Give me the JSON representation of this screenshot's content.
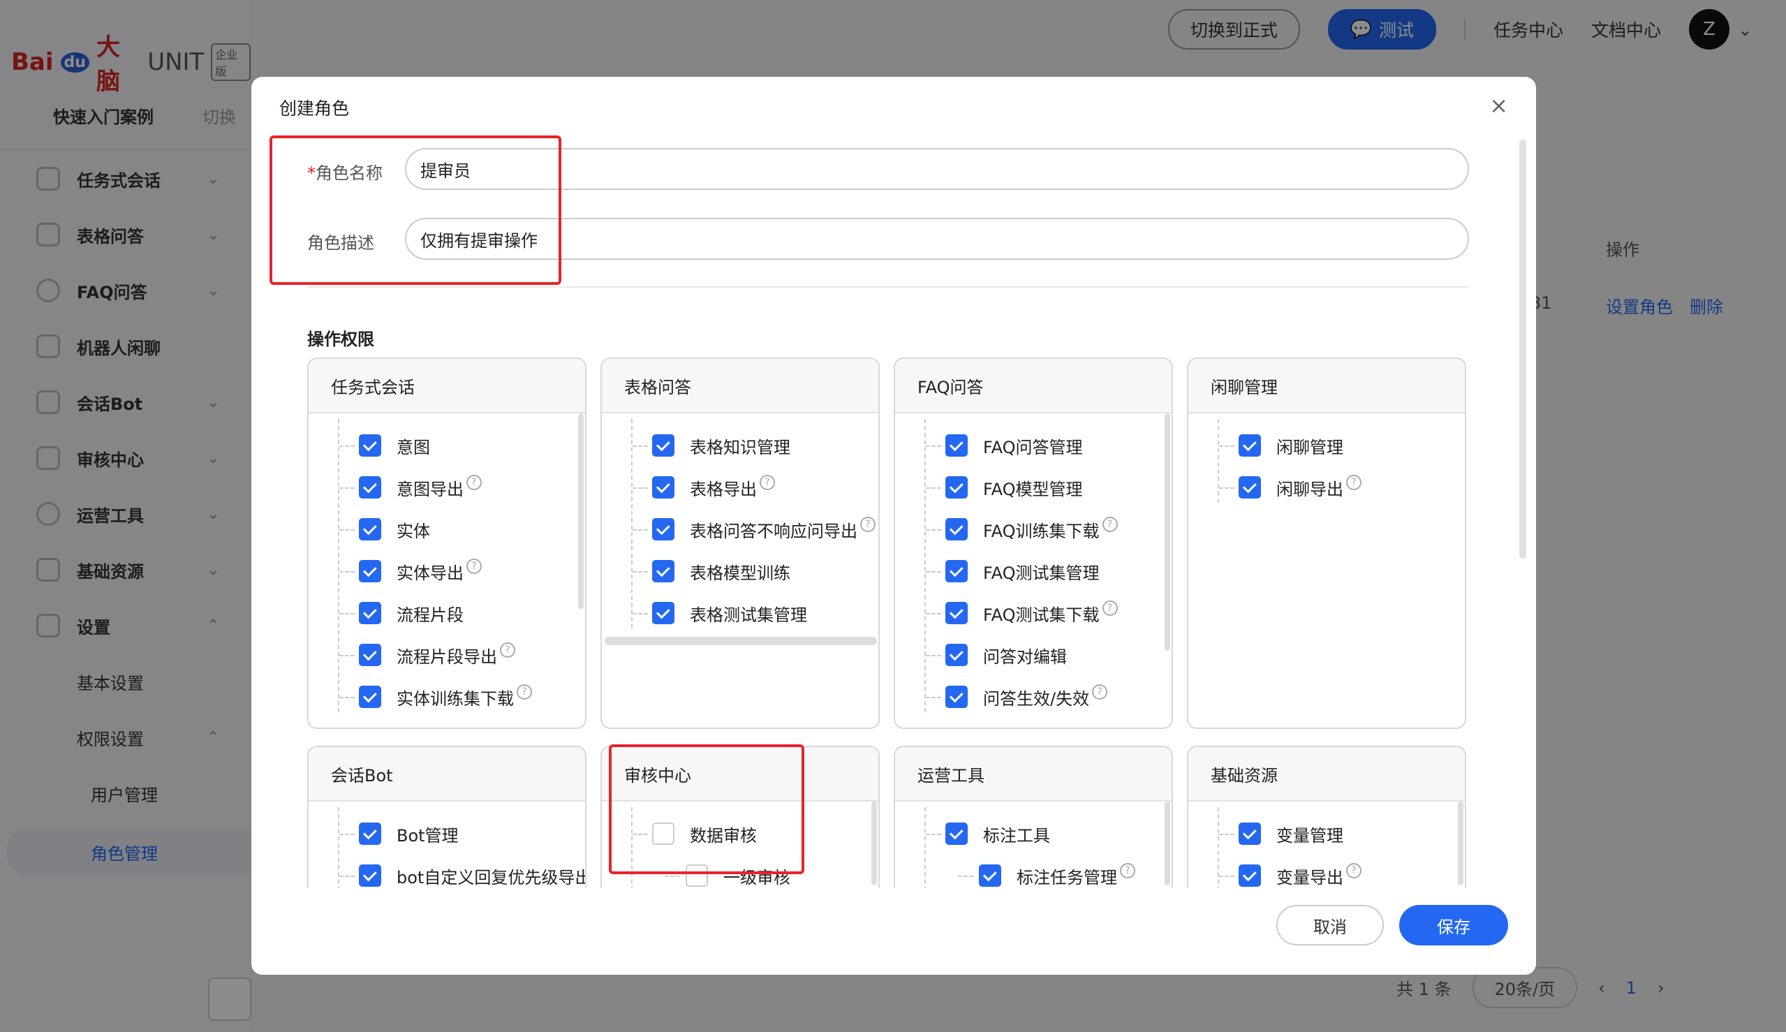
{
  "topbar": {
    "switch_formal": "切换到正式",
    "test": "测试",
    "task_center": "任务中心",
    "doc_center": "文档中心",
    "avatar_letter": "Z"
  },
  "sidebar": {
    "logo_main": "Bai",
    "logo_du": "du",
    "logo_brain": "大脑",
    "logo_unit": "UNIT",
    "logo_edition": "企业版",
    "quick_start": "快速入门案例",
    "switch": "切换",
    "items": [
      {
        "label": "任务式会话",
        "chev": "⌄"
      },
      {
        "label": "表格问答",
        "chev": "⌄"
      },
      {
        "label": "FAQ问答",
        "chev": "⌄"
      },
      {
        "label": "机器人闲聊",
        "chev": ""
      },
      {
        "label": "会话Bot",
        "chev": "⌄"
      },
      {
        "label": "审核中心",
        "chev": "⌄"
      },
      {
        "label": "运营工具",
        "chev": "⌄"
      },
      {
        "label": "基础资源",
        "chev": "⌄"
      },
      {
        "label": "设置",
        "chev": "⌃"
      },
      {
        "label": "基本设置",
        "chev": ""
      },
      {
        "label": "权限设置",
        "chev": "⌃"
      },
      {
        "label": "用户管理",
        "chev": ""
      },
      {
        "label": "角色管理",
        "chev": ""
      }
    ]
  },
  "background": {
    "col_action": "操作",
    "cell_partial": "31",
    "set_role": "设置角色",
    "delete": "删除",
    "total": "共 1 条",
    "page_size": "20条/页",
    "page_num": "1",
    "prev": "‹",
    "next": "›"
  },
  "modal": {
    "title": "创建角色",
    "close": "×",
    "name_label": "角色名称",
    "name_required": "*",
    "name_value": "提审员",
    "desc_label": "角色描述",
    "desc_value": "仅拥有提审操作",
    "perm_title": "操作权限",
    "cancel": "取消",
    "save": "保存",
    "cards": [
      {
        "title": "任务式会话",
        "items": [
          {
            "label": "意图",
            "checked": true,
            "help": false
          },
          {
            "label": "意图导出",
            "checked": true,
            "help": true
          },
          {
            "label": "实体",
            "checked": true,
            "help": false
          },
          {
            "label": "实体导出",
            "checked": true,
            "help": true
          },
          {
            "label": "流程片段",
            "checked": true,
            "help": false
          },
          {
            "label": "流程片段导出",
            "checked": true,
            "help": true
          },
          {
            "label": "实体训练集下载",
            "checked": true,
            "help": true
          }
        ]
      },
      {
        "title": "表格问答",
        "items": [
          {
            "label": "表格知识管理",
            "checked": true,
            "help": false
          },
          {
            "label": "表格导出",
            "checked": true,
            "help": true
          },
          {
            "label": "表格问答不响应问导出",
            "checked": true,
            "help": true
          },
          {
            "label": "表格模型训练",
            "checked": true,
            "help": false
          },
          {
            "label": "表格测试集管理",
            "checked": true,
            "help": false
          }
        ]
      },
      {
        "title": "FAQ问答",
        "items": [
          {
            "label": "FAQ问答管理",
            "checked": true,
            "help": false
          },
          {
            "label": "FAQ模型管理",
            "checked": true,
            "help": false
          },
          {
            "label": "FAQ训练集下载",
            "checked": true,
            "help": true
          },
          {
            "label": "FAQ测试集管理",
            "checked": true,
            "help": false
          },
          {
            "label": "FAQ测试集下载",
            "checked": true,
            "help": true
          },
          {
            "label": "问答对编辑",
            "checked": true,
            "help": false
          },
          {
            "label": "问答生效/失效",
            "checked": true,
            "help": true
          }
        ]
      },
      {
        "title": "闲聊管理",
        "items": [
          {
            "label": "闲聊管理",
            "checked": true,
            "help": false
          },
          {
            "label": "闲聊导出",
            "checked": true,
            "help": true
          }
        ]
      },
      {
        "title": "会话Bot",
        "items": [
          {
            "label": "Bot管理",
            "checked": true,
            "help": false
          },
          {
            "label": "bot自定义回复优先级导出",
            "checked": true,
            "help": false
          }
        ]
      },
      {
        "title": "审核中心",
        "items": [
          {
            "label": "数据审核",
            "checked": false,
            "help": false
          },
          {
            "label": "一级审核",
            "checked": false,
            "help": false
          }
        ]
      },
      {
        "title": "运营工具",
        "items": [
          {
            "label": "标注工具",
            "checked": true,
            "help": false
          },
          {
            "label": "标注任务管理",
            "checked": true,
            "help": true
          }
        ]
      },
      {
        "title": "基础资源",
        "items": [
          {
            "label": "变量管理",
            "checked": true,
            "help": false
          },
          {
            "label": "变量导出",
            "checked": true,
            "help": true
          }
        ]
      }
    ]
  },
  "colors": {
    "accent": "#2468f2",
    "highlight": "#e8232c"
  }
}
